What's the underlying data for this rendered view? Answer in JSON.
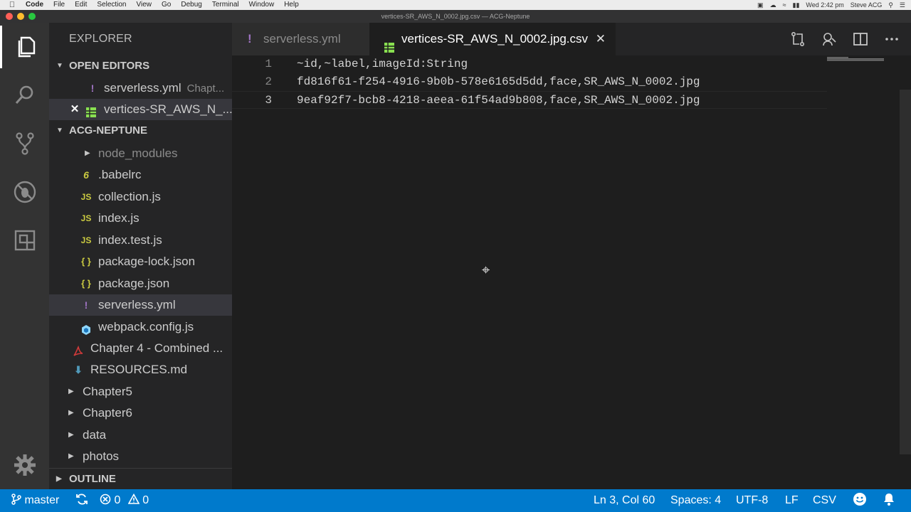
{
  "menubar": {
    "app": "Code",
    "items": [
      "File",
      "Edit",
      "Selection",
      "View",
      "Go",
      "Debug",
      "Terminal",
      "Window",
      "Help"
    ],
    "clock": "Wed 2:42 pm",
    "user": "Steve ACG"
  },
  "window": {
    "title": "vertices-SR_AWS_N_0002.jpg.csv — ACG-Neptune"
  },
  "sidebar": {
    "title": "EXPLORER",
    "open_editors_label": "OPEN EDITORS",
    "open_editors": [
      {
        "name": "serverless.yml",
        "desc": "Chapt...",
        "icon": "!"
      },
      {
        "name": "vertices-SR_AWS_N_...",
        "desc": "",
        "icon": "csv"
      }
    ],
    "project_label": "ACG-NEPTUNE",
    "tree": [
      {
        "name": "node_modules",
        "type": "folder"
      },
      {
        "name": ".babelrc",
        "type": "babel"
      },
      {
        "name": "collection.js",
        "type": "js"
      },
      {
        "name": "index.js",
        "type": "js"
      },
      {
        "name": "index.test.js",
        "type": "js"
      },
      {
        "name": "package-lock.json",
        "type": "json"
      },
      {
        "name": "package.json",
        "type": "json"
      },
      {
        "name": "serverless.yml",
        "type": "yml"
      },
      {
        "name": "webpack.config.js",
        "type": "webpack"
      },
      {
        "name": "Chapter 4 - Combined ...",
        "type": "pdf"
      },
      {
        "name": "RESOURCES.md",
        "type": "md"
      },
      {
        "name": "Chapter5",
        "type": "folder"
      },
      {
        "name": "Chapter6",
        "type": "folder"
      },
      {
        "name": "data",
        "type": "folder"
      },
      {
        "name": "photos",
        "type": "folder"
      }
    ],
    "outline_label": "OUTLINE",
    "icons": {
      "js": "JS",
      "json": "{ }",
      "yml": "!",
      "babel": "6"
    }
  },
  "tabs": [
    {
      "label": "serverless.yml",
      "icon": "!"
    },
    {
      "label": "vertices-SR_AWS_N_0002.jpg.csv",
      "icon": "csv",
      "close": "✕"
    }
  ],
  "editor": {
    "lines": [
      {
        "num": "1",
        "text": "~id,~label,imageId:String"
      },
      {
        "num": "2",
        "text": "fd816f61-f254-4916-9b0b-578e6165d5dd,face,SR_AWS_N_0002.jpg"
      },
      {
        "num": "3",
        "text": "9eaf92f7-bcb8-4218-aeea-61f54ad9b808,face,SR_AWS_N_0002.jpg"
      }
    ]
  },
  "statusbar": {
    "branch": "master",
    "errors": "0",
    "warnings": "0",
    "position": "Ln 3, Col 60",
    "spaces": "Spaces: 4",
    "encoding": "UTF-8",
    "eol": "LF",
    "language": "CSV"
  },
  "colors": {
    "statusbar": "#007acc",
    "js": "#cbcb41",
    "json": "#cbcb41",
    "yml": "#a074c4",
    "csv": "#89e051",
    "pdf": "#d03a3a",
    "md": "#519aba"
  }
}
